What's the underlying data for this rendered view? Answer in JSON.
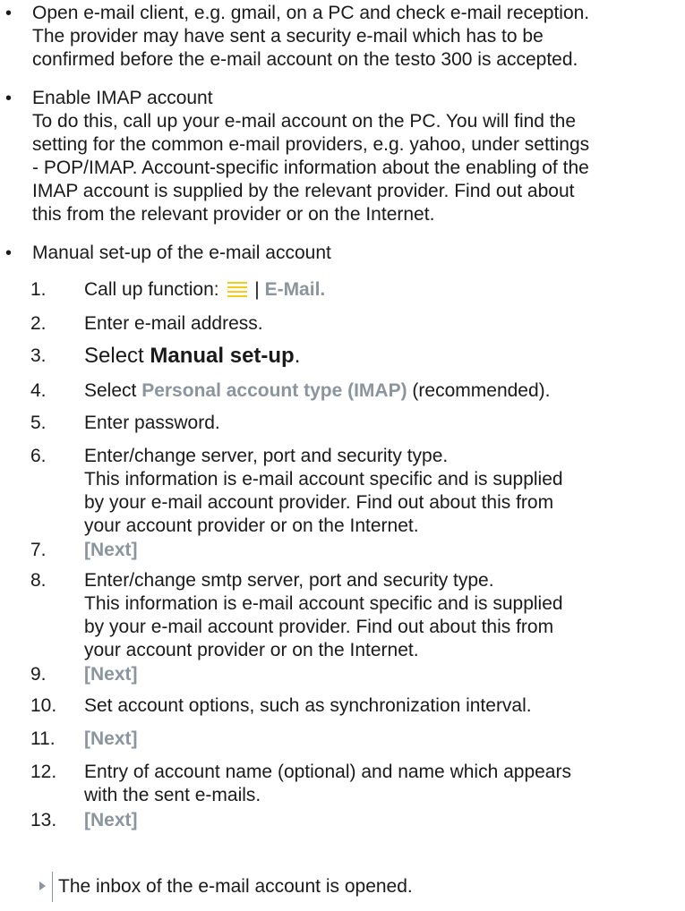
{
  "bullets": [
    {
      "lines": [
        "Open e-mail client, e.g. gmail, on a PC and check e-mail reception.",
        "The provider may have sent a security e-mail which has to be",
        "confirmed before the e-mail account on the testo 300 is accepted."
      ]
    },
    {
      "lines": [
        "Enable IMAP account",
        "To do this, call up your e-mail account on the PC. You will find the",
        "setting for the common e-mail providers, e.g. yahoo, under settings",
        "- POP/IMAP. Account-specific information about the enabling of the",
        "IMAP account is supplied by the relevant provider. Find out about",
        "this from the relevant provider or on the Internet."
      ]
    },
    {
      "lines": [
        "Manual set-up of the e-mail account"
      ]
    }
  ],
  "steps": {
    "s1": {
      "num": "1.",
      "prefix": "Call up function: ",
      "sep": " | ",
      "target": "E-Mail."
    },
    "s2": {
      "num": "2.",
      "text": "Enter e-mail address."
    },
    "s3": {
      "num": "3.",
      "prefix": "Select ",
      "bold": "Manual set-up",
      "suffix": "."
    },
    "s4": {
      "num": "4.",
      "prefix": "Select ",
      "highlight": "Personal account type (IMAP)",
      "suffix": " (recommended)."
    },
    "s5": {
      "num": "5.",
      "text": "Enter password."
    },
    "s6": {
      "num": "6.",
      "lines": [
        "Enter/change server, port and security type.",
        "This information is e-mail account specific and is supplied",
        "by your e-mail account provider. Find out about this from",
        "your account provider or on the Internet."
      ]
    },
    "s7": {
      "num": "7.",
      "text": "[Next]"
    },
    "s8": {
      "num": "8.",
      "lines": [
        "Enter/change smtp server, port and security type.",
        "This information is e-mail account specific and is supplied",
        "by your e-mail account provider. Find out about this from",
        "your account provider or on the Internet."
      ]
    },
    "s9": {
      "num": "9.",
      "text": "[Next]"
    },
    "s10": {
      "num": "10.",
      "text": "Set account options, such as synchronization interval."
    },
    "s11": {
      "num": "11.",
      "text": "[Next]"
    },
    "s12": {
      "num": "12.",
      "lines": [
        "Entry of account name (optional) and name which appears",
        "with the sent e-mails."
      ]
    },
    "s13": {
      "num": "13.",
      "text": "[Next]"
    }
  },
  "result": "The inbox of the e-mail account is opened.",
  "icons": {
    "menu": "menu-lines-icon"
  },
  "colors": {
    "accent_gray": "#8a959d",
    "menu_icon": "#f2cc1a"
  }
}
